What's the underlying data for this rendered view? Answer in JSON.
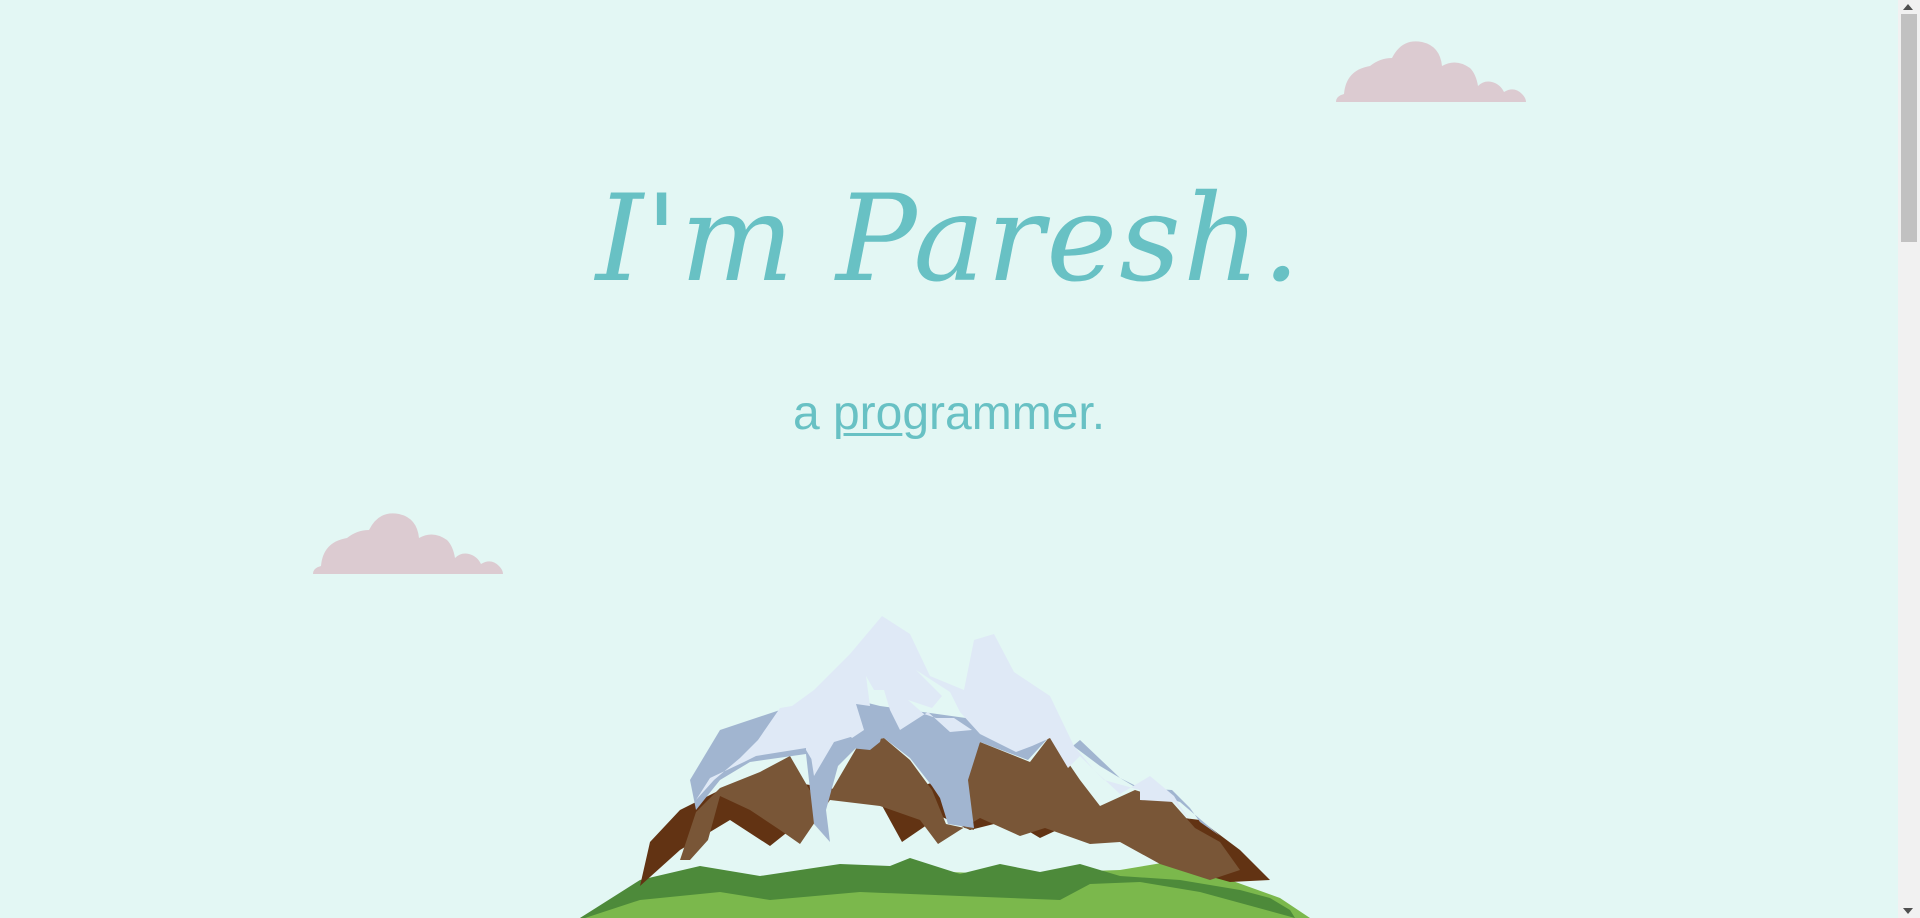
{
  "hero": {
    "title": "I'm Paresh.",
    "subtitle_prefix": "a ",
    "subtitle_typed": "pro",
    "subtitle_rest": "grammer."
  },
  "colors": {
    "background": "#e3f7f4",
    "accent": "#68c1c4",
    "cloud": "#dccbd1",
    "snow": "#dfe9f6",
    "snow_shadow": "#a1b5d0",
    "rock": "#795637",
    "rock_dark": "#623313",
    "grass_dark": "#4d8a3a",
    "grass_light": "#7bb84c"
  },
  "decor": {
    "cloud_icon": "cloud-icon",
    "mountain_icon": "mountain-illustration"
  }
}
